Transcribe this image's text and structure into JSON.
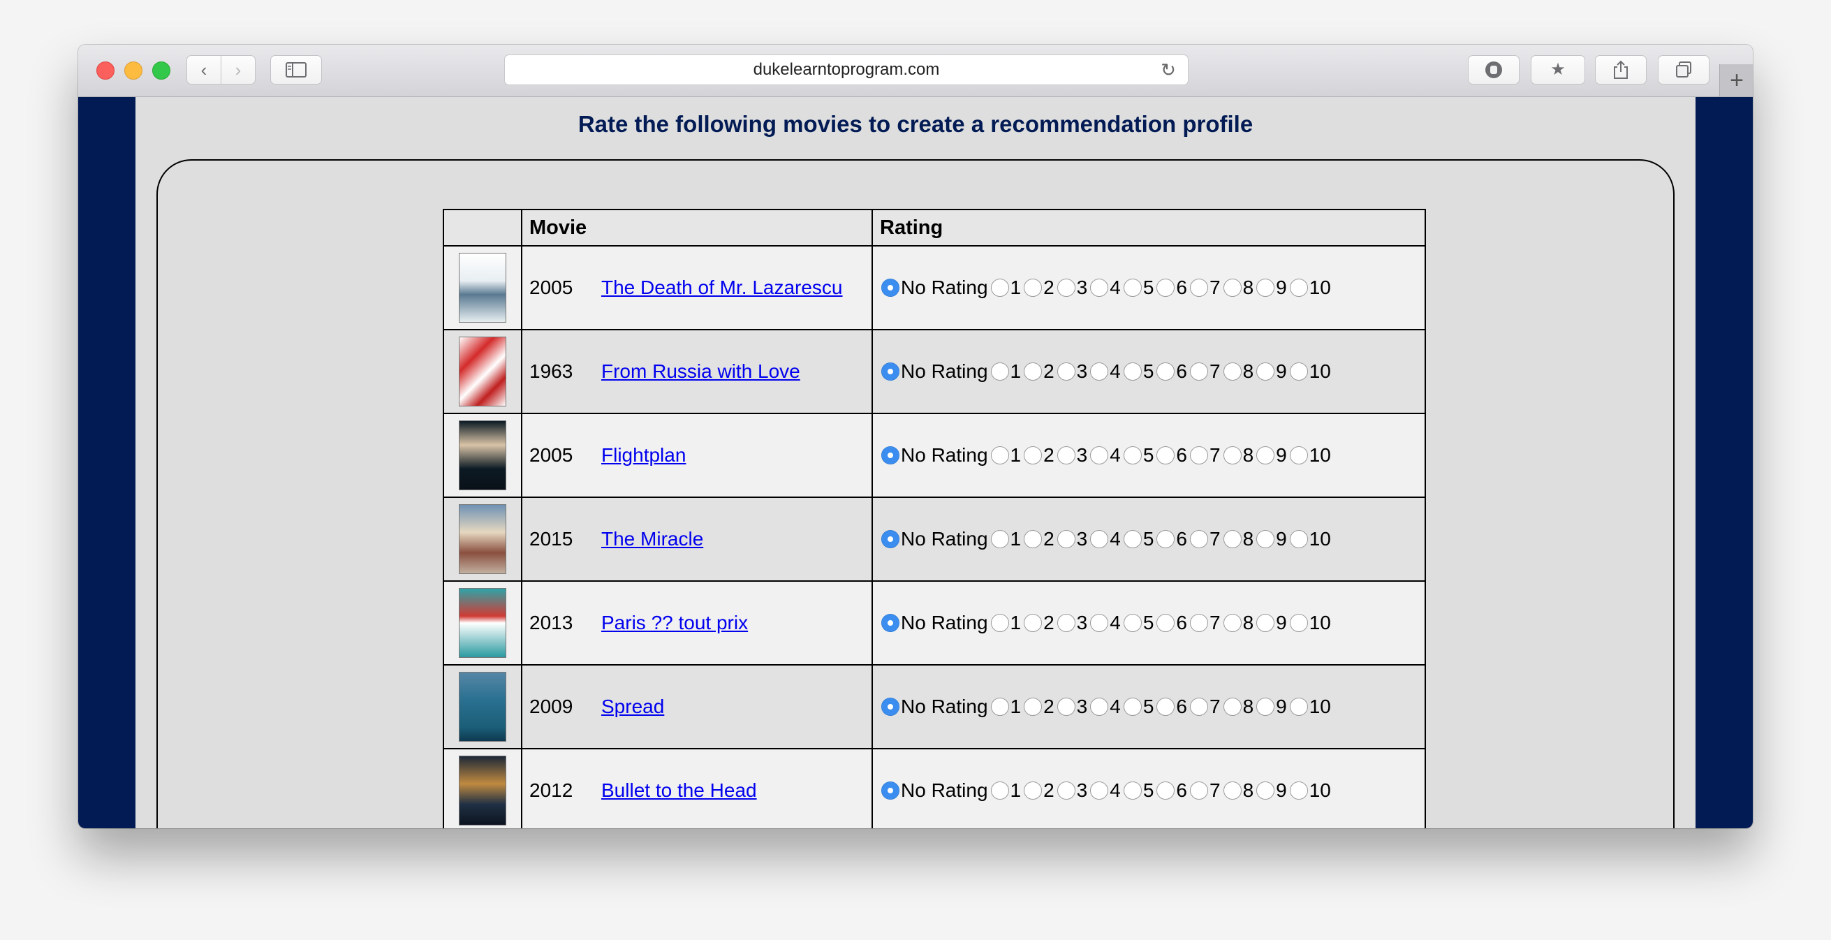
{
  "browser": {
    "url": "dukelearntoprogram.com"
  },
  "page": {
    "heading": "Rate the following movies to create a recommendation profile"
  },
  "table": {
    "headers": [
      "",
      "Movie",
      "Rating"
    ],
    "rating_options": [
      "No Rating",
      "1",
      "2",
      "3",
      "4",
      "5",
      "6",
      "7",
      "8",
      "9",
      "10"
    ],
    "selected_rating": "No Rating",
    "rows": [
      {
        "year": "2005",
        "title": "The Death of Mr. Lazarescu"
      },
      {
        "year": "1963",
        "title": "From Russia with Love"
      },
      {
        "year": "2005",
        "title": "Flightplan"
      },
      {
        "year": "2015",
        "title": "The Miracle"
      },
      {
        "year": "2013",
        "title": "Paris ?? tout prix"
      },
      {
        "year": "2009",
        "title": "Spread"
      },
      {
        "year": "2012",
        "title": "Bullet to the Head"
      }
    ]
  },
  "colors": {
    "sidebar": "#021b54",
    "heading": "#021b54",
    "link": "#0000ee",
    "radio_selected": "#3b8df0"
  }
}
